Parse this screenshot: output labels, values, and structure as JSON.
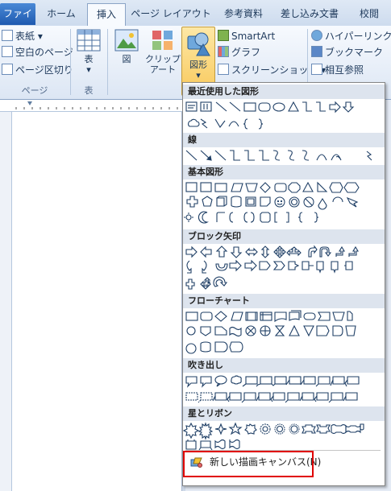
{
  "tabs": [
    "ファイル",
    "ホーム",
    "挿入",
    "ページ レイアウト",
    "参考資料",
    "差し込み文書",
    "校閲"
  ],
  "ribbon": {
    "page_group": {
      "cover": "表紙 ▾",
      "blank": "空白のページ",
      "break": "ページ区切り",
      "label": "ページ"
    },
    "table_group": {
      "table": "表",
      "arrow": "▾",
      "label": "表"
    },
    "illus": {
      "picture": "図",
      "clipart_1": "クリップ",
      "clipart_2": "アート",
      "shapes": "図形",
      "shapes_arrow": "▾",
      "smartart": "SmartArt",
      "chart": "グラフ",
      "screenshot": "スクリーンショット ▾"
    },
    "links": {
      "hyperlink": "ハイパーリンク",
      "bookmark": "ブックマーク",
      "crossref": "相互参照"
    }
  },
  "menu": {
    "sections": [
      "最近使用した図形",
      "線",
      "基本図形",
      "ブロック矢印",
      "フローチャート",
      "吹き出し",
      "星とリボン"
    ],
    "new_canvas": "新しい描画キャンバス(N)"
  },
  "colors": {
    "accent": "#e00000",
    "shape_stroke": "#1f3f66",
    "section_bg": "#dde4ee"
  }
}
